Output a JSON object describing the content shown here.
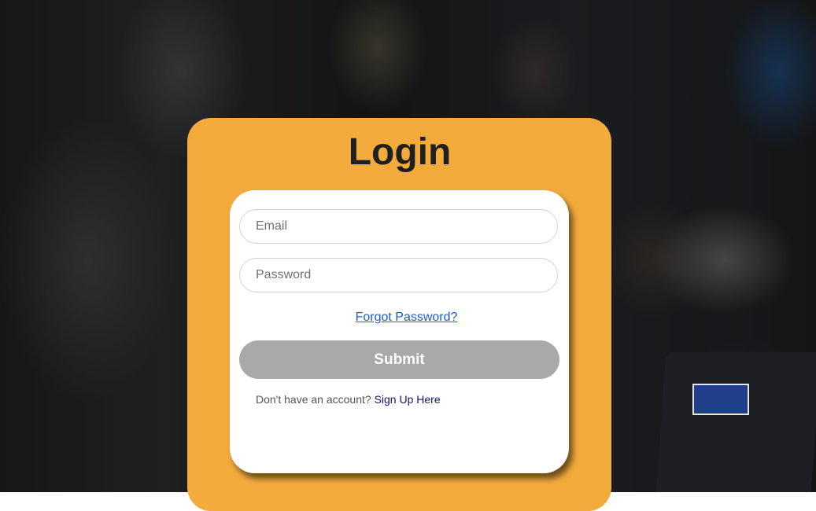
{
  "login": {
    "title": "Login",
    "email_placeholder": "Email",
    "password_placeholder": "Password",
    "forgot_password": "Forgot Password?",
    "submit_label": "Submit",
    "signup_prompt": "Don't have an account?",
    "signup_link": "Sign Up Here"
  },
  "colors": {
    "card_background": "#f3ab3c",
    "panel_background": "#ffffff",
    "submit_background": "#a9a9a9",
    "link_blue": "#1a5ed1",
    "signup_link": "#12156b",
    "title_text": "#1f1f1f"
  }
}
